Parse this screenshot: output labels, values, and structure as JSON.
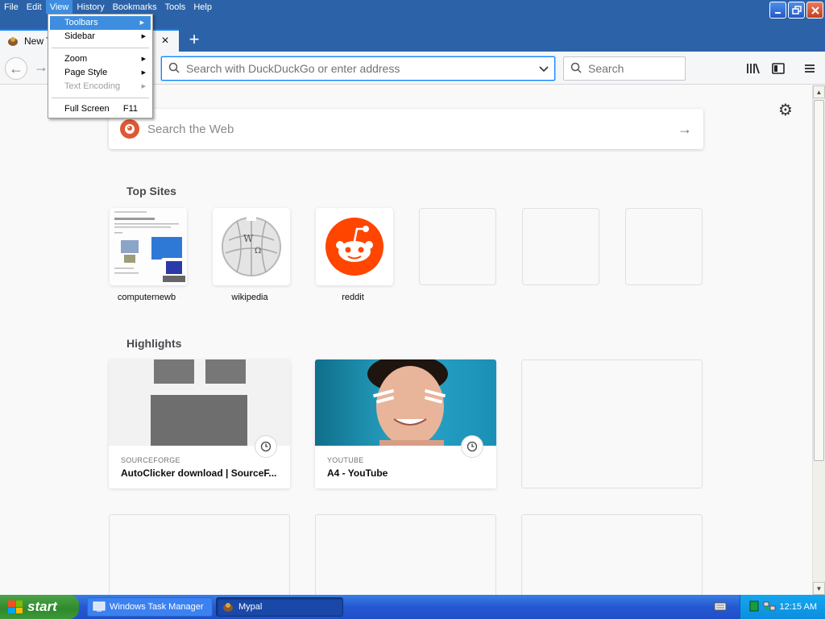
{
  "menubar": {
    "items": [
      {
        "label": "File"
      },
      {
        "label": "Edit"
      },
      {
        "label": "View"
      },
      {
        "label": "History"
      },
      {
        "label": "Bookmarks"
      },
      {
        "label": "Tools"
      },
      {
        "label": "Help"
      }
    ]
  },
  "view_menu": {
    "items": [
      {
        "label": "Toolbars",
        "submenu": true
      },
      {
        "label": "Sidebar",
        "submenu": true
      },
      {
        "label": "Zoom",
        "submenu": true
      },
      {
        "label": "Page Style",
        "submenu": true
      },
      {
        "label": "Text Encoding",
        "submenu": true,
        "disabled": true
      },
      {
        "label": "Full Screen",
        "shortcut": "F11"
      }
    ]
  },
  "tab": {
    "title": "New Tab"
  },
  "toolbar": {
    "url_placeholder": "Search with DuckDuckGo or enter address",
    "search_placeholder": "Search"
  },
  "newtab": {
    "search_placeholder": "Search the Web",
    "top_sites_title": "Top Sites",
    "top_sites": [
      {
        "label": "computernewb"
      },
      {
        "label": "wikipedia"
      },
      {
        "label": "reddit"
      },
      {
        "label": ""
      },
      {
        "label": ""
      },
      {
        "label": ""
      }
    ],
    "highlights_title": "Highlights",
    "highlights": [
      {
        "source": "SOURCEFORGE",
        "title": "AutoClicker download | SourceF..."
      },
      {
        "source": "YOUTUBE",
        "title": "A4 - YouTube"
      }
    ]
  },
  "taskbar": {
    "start_label": "start",
    "tasks": [
      {
        "label": "Windows Task Manager"
      },
      {
        "label": "Mypal"
      }
    ],
    "clock": "12:15 AM"
  },
  "colors": {
    "accent": "#0a84ff",
    "titlebar": "#2c63a8",
    "reddit": "#ff4500",
    "duckduckgo": "#de5833"
  }
}
